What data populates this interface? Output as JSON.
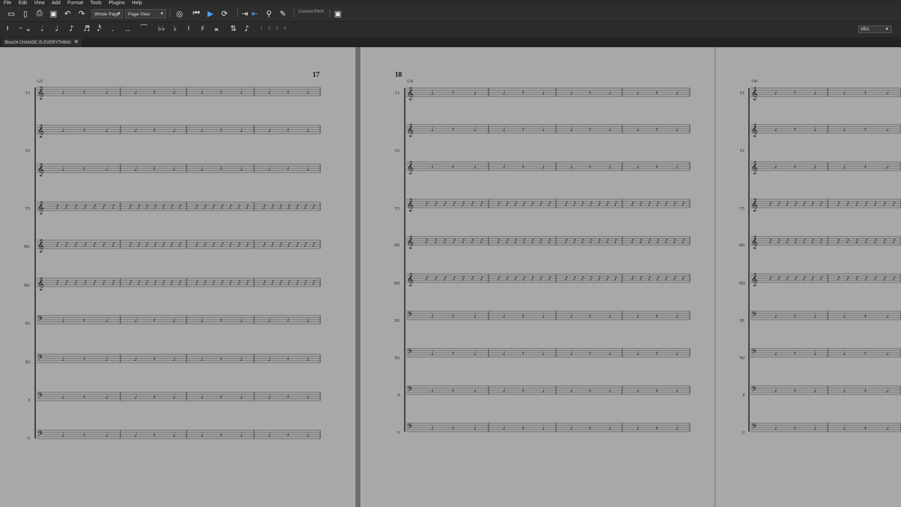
{
  "menu": [
    "File",
    "Edit",
    "View",
    "Add",
    "Format",
    "Tools",
    "Plugins",
    "Help"
  ],
  "toolbar": {
    "page_mode": "Whole Page",
    "view_mode": "Page View",
    "concert_pitch": "Concert Pitch"
  },
  "note_input": {
    "voices": [
      "1",
      "2",
      "3",
      "4"
    ],
    "palette_preset": "MDL"
  },
  "tabs": [
    {
      "label": "Bloo24 CHANGE IS EVERYTHING"
    }
  ],
  "score": {
    "pages": [
      {
        "page_number": "17",
        "measure_number": "122",
        "instruments": [
          "T1",
          "T2",
          "T3",
          "M1",
          "M2",
          "B1",
          "B2",
          "E",
          "U"
        ]
      },
      {
        "page_number": "18",
        "measure_number": "126",
        "instruments": [
          "T1",
          "T2",
          "T3",
          "M1",
          "M2",
          "B1",
          "B2",
          "E",
          "U"
        ]
      },
      {
        "page_number": "",
        "measure_number": "130",
        "instruments": [
          "T1",
          "T2",
          "T3",
          "M1",
          "M2",
          "B1",
          "B2",
          "E",
          "U"
        ]
      }
    ],
    "dynamics": [
      "mf",
      "mp",
      "f"
    ]
  },
  "colors": {
    "menubar": "#2a2a2a",
    "toolbar": "#2e2e2e",
    "page": "#a8a8a8",
    "accent": "#4aa3ff"
  }
}
